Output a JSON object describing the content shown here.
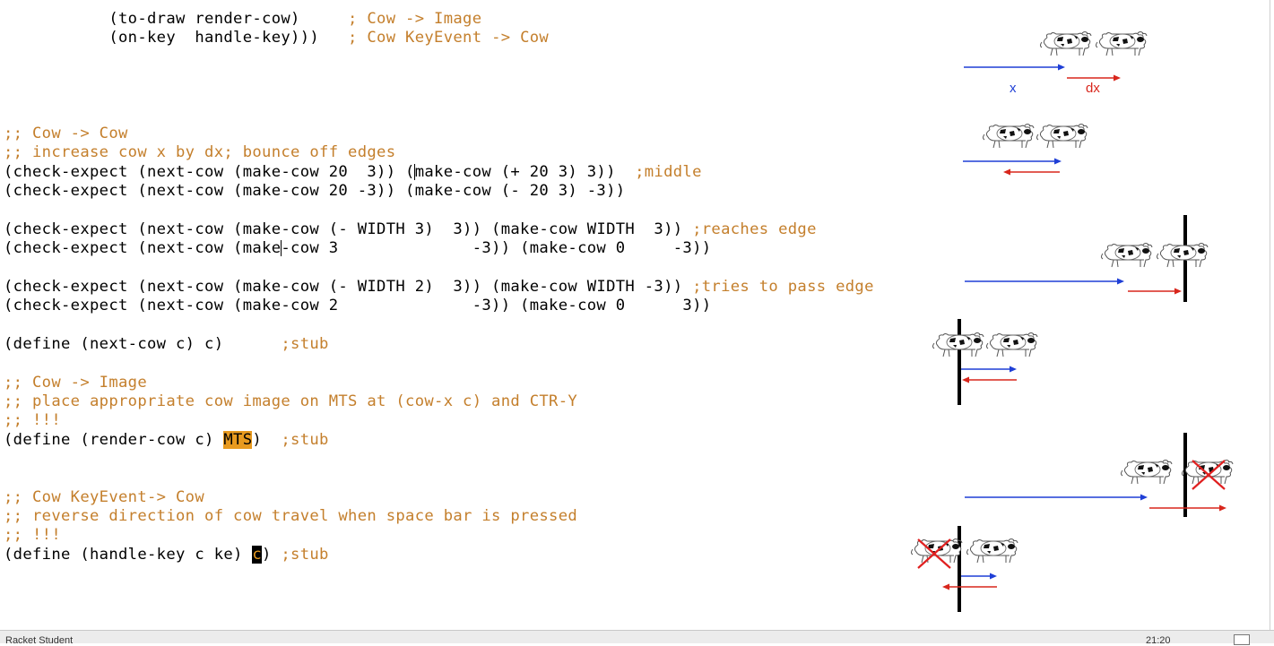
{
  "code": {
    "line_to_draw": {
      "code": "           (to-draw render-cow)     ",
      "comment": "; Cow -> Image"
    },
    "line_on_key": {
      "code": "           (on-key  handle-key)))   ",
      "comment": "; Cow KeyEvent -> Cow"
    },
    "next_cow_sig": ";; Cow -> Cow",
    "next_cow_purpose": ";; increase cow x by dx; bounce off edges",
    "test1": {
      "pre": "(check-expect (next-cow (make-cow 20  3)) (",
      "post": "make-cow (+ 20 3) 3))  ",
      "comment": ";middle"
    },
    "test2": "(check-expect (next-cow (make-cow 20 -3)) (make-cow (- 20 3) -3))",
    "test3": {
      "code": "(check-expect (next-cow (make-cow (- WIDTH 3)  3)) (make-cow WIDTH  3)) ",
      "comment": ";reaches edge"
    },
    "test4": {
      "pre": "(check-expect (next-cow (make",
      "post": "-cow 3              -3)) (make-cow 0     -3))"
    },
    "test5": {
      "code": "(check-expect (next-cow (make-cow (- WIDTH 2)  3)) (make-cow WIDTH -3)) ",
      "comment": ";tries to pass edge"
    },
    "test6": "(check-expect (next-cow (make-cow 2              -3)) (make-cow 0      3))",
    "define_next_cow": {
      "code": "(define (next-cow c) c)      ",
      "comment": ";stub"
    },
    "render_sig": ";; Cow -> Image",
    "render_purpose": ";; place appropriate cow image on MTS at (cow-x c) and CTR-Y",
    "render_bangs": ";; !!!",
    "define_render": {
      "pre": "(define (render-cow c) ",
      "highlight": "MTS",
      "post": ")  ",
      "comment": ";stub"
    },
    "handle_sig": ";; Cow KeyEvent-> Cow",
    "handle_purpose": ";; reverse direction of cow travel when space bar is pressed",
    "handle_bangs": ";; !!!",
    "define_handle": {
      "pre": "(define (handle-key c ke) ",
      "highlight": "c",
      "post": ") ",
      "comment": ";stub"
    }
  },
  "diagram_labels": {
    "x": "x",
    "dx": "dx"
  },
  "status": {
    "left": "Racket Student",
    "position": "21:20"
  },
  "colors": {
    "comment": "#c47f2c",
    "highlight": "#e89a1f",
    "arrow_x": "#1f3fd6",
    "arrow_dx": "#d8261c",
    "cross": "#e02020"
  }
}
